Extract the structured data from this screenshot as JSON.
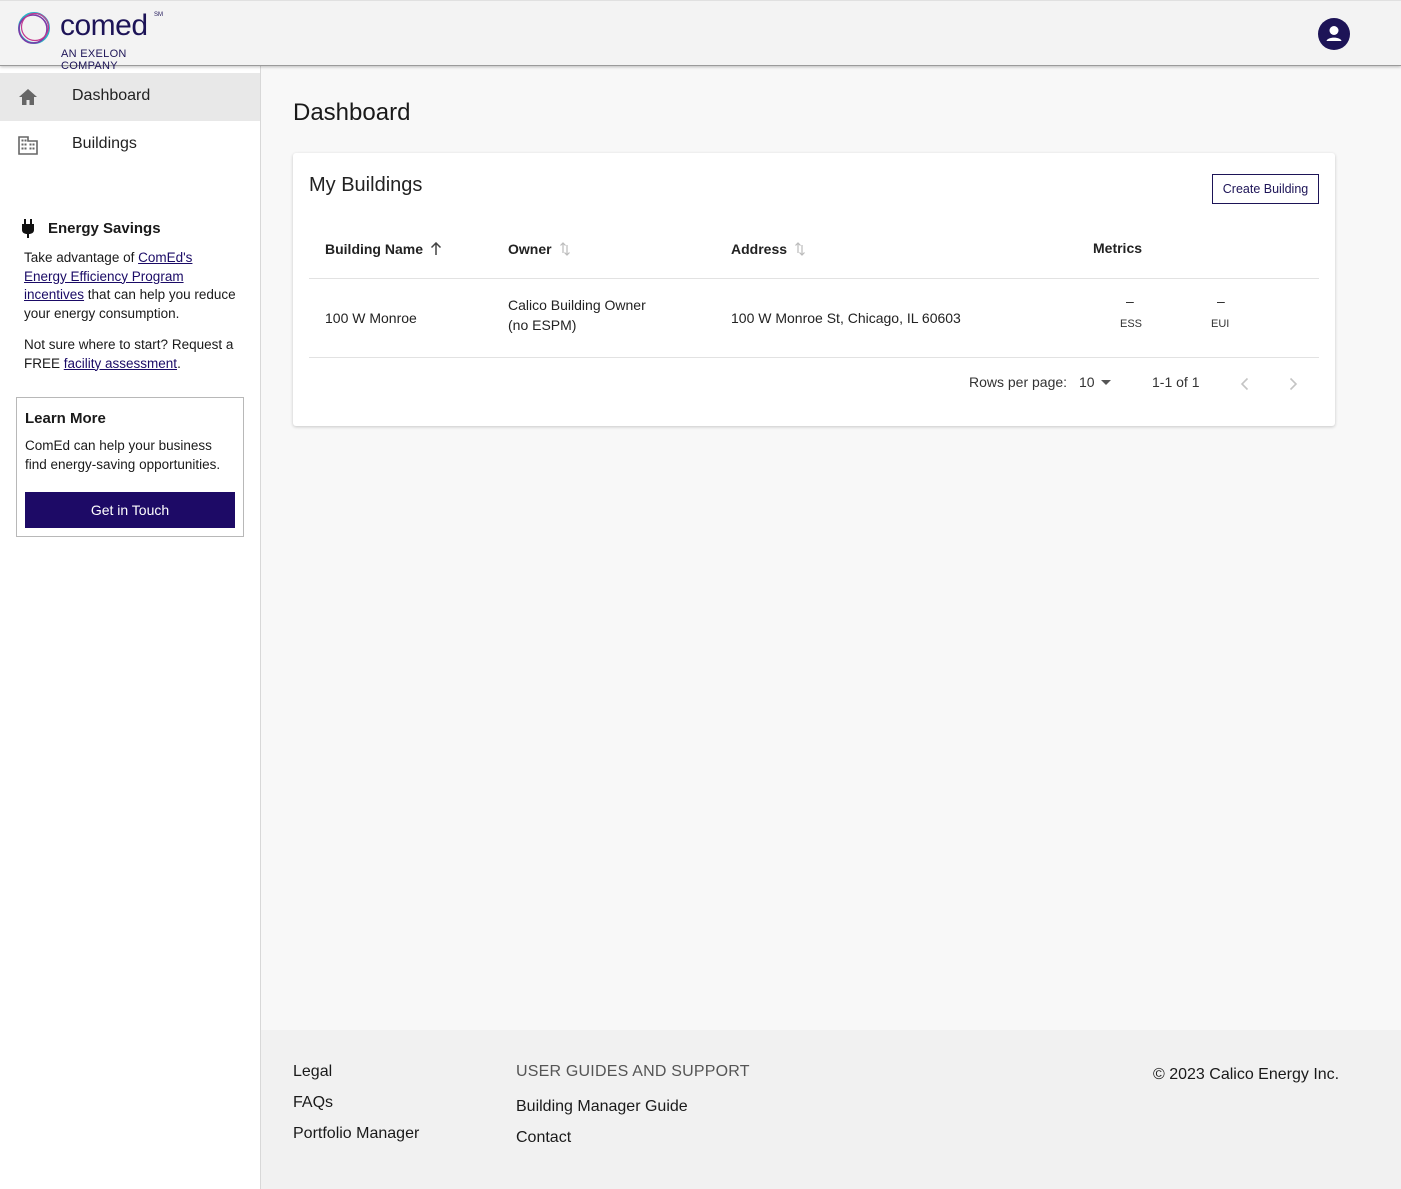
{
  "header": {
    "logo_word": "comed",
    "logo_mark": "SM",
    "logo_sub": "AN EXELON COMPANY",
    "avatar_icon": "user-avatar-icon"
  },
  "sidebar": {
    "nav": [
      {
        "label": "Dashboard",
        "icon": "home-icon",
        "active": true
      },
      {
        "label": "Buildings",
        "icon": "building-icon",
        "active": false
      }
    ],
    "energy": {
      "title": "Energy Savings",
      "p1_prefix": "Take advantage of ",
      "p1_link": "ComEd's Energy Efficiency Program incentives",
      "p1_suffix": " that can help you reduce your energy consumption.",
      "p2_prefix": "Not sure where to start? Request a FREE ",
      "p2_link": "facility assessment",
      "p2_suffix": "."
    },
    "learn": {
      "title": "Learn More",
      "text": "ComEd can help your business find energy-saving opportunities.",
      "button": "Get in Touch"
    }
  },
  "main": {
    "title": "Dashboard",
    "card": {
      "title": "My Buildings",
      "create_button": "Create Building",
      "columns": [
        "Building Name",
        "Owner",
        "Address",
        "Metrics"
      ],
      "rows": [
        {
          "name": "100 W Monroe",
          "owner_line1": "Calico Building Owner",
          "owner_line2": "(no ESPM)",
          "address": "100 W Monroe St, Chicago, IL 60603",
          "ess_value": "–",
          "ess_label": "ESS",
          "eui_value": "–",
          "eui_label": "EUI"
        }
      ],
      "pagination": {
        "rows_label": "Rows per page:",
        "rows_value": "10",
        "range": "1-1 of 1"
      }
    }
  },
  "footer": {
    "links": [
      "Legal",
      "FAQs",
      "Portfolio Manager"
    ],
    "support_heading": "USER GUIDES AND SUPPORT",
    "support_links": [
      "Building Manager Guide",
      "Contact"
    ],
    "copyright": "© 2023 Calico Energy Inc."
  }
}
